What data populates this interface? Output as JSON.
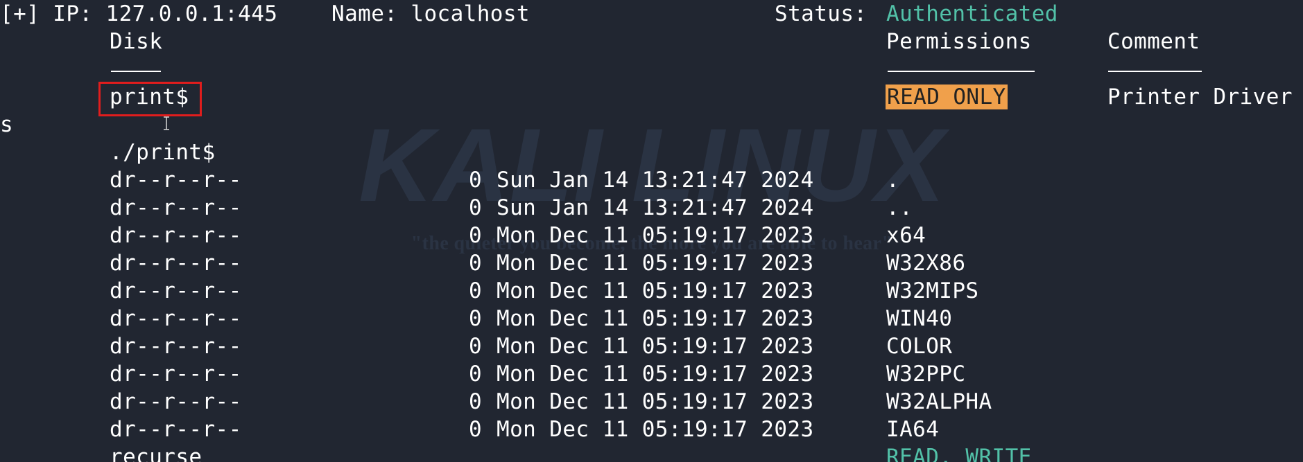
{
  "header": {
    "ip_line": "[+] IP: 127.0.0.1:445",
    "name_line": "Name: localhost",
    "status_label": "Status:",
    "status_value": "Authenticated"
  },
  "columns": {
    "disk": "Disk",
    "permissions": "Permissions",
    "comment": "Comment"
  },
  "share": {
    "name": "print$",
    "permission": "READ ONLY",
    "comment": "Printer Driver",
    "comment_wrap": "s",
    "path": "./print$"
  },
  "listing": [
    {
      "perm": "dr--r--r--",
      "size": "0",
      "date": "Sun Jan 14 13:21:47 2024",
      "name": "."
    },
    {
      "perm": "dr--r--r--",
      "size": "0",
      "date": "Sun Jan 14 13:21:47 2024",
      "name": ".."
    },
    {
      "perm": "dr--r--r--",
      "size": "0",
      "date": "Mon Dec 11 05:19:17 2023",
      "name": "x64"
    },
    {
      "perm": "dr--r--r--",
      "size": "0",
      "date": "Mon Dec 11 05:19:17 2023",
      "name": "W32X86"
    },
    {
      "perm": "dr--r--r--",
      "size": "0",
      "date": "Mon Dec 11 05:19:17 2023",
      "name": "W32MIPS"
    },
    {
      "perm": "dr--r--r--",
      "size": "0",
      "date": "Mon Dec 11 05:19:17 2023",
      "name": "WIN40"
    },
    {
      "perm": "dr--r--r--",
      "size": "0",
      "date": "Mon Dec 11 05:19:17 2023",
      "name": "COLOR"
    },
    {
      "perm": "dr--r--r--",
      "size": "0",
      "date": "Mon Dec 11 05:19:17 2023",
      "name": "W32PPC"
    },
    {
      "perm": "dr--r--r--",
      "size": "0",
      "date": "Mon Dec 11 05:19:17 2023",
      "name": "W32ALPHA"
    },
    {
      "perm": "dr--r--r--",
      "size": "0",
      "date": "Mon Dec 11 05:19:17 2023",
      "name": "IA64"
    }
  ],
  "next_share": {
    "name": "recurse",
    "permission": "READ, WRITE"
  },
  "watermark": {
    "title": "KALI LINUX",
    "tagline": "\"the quieter you become, the more you are able to hear\""
  },
  "colors": {
    "background": "#212631",
    "authenticated": "#52c1a8",
    "read_only_bg": "#f0a04b",
    "selection_box": "#e11d1d"
  }
}
